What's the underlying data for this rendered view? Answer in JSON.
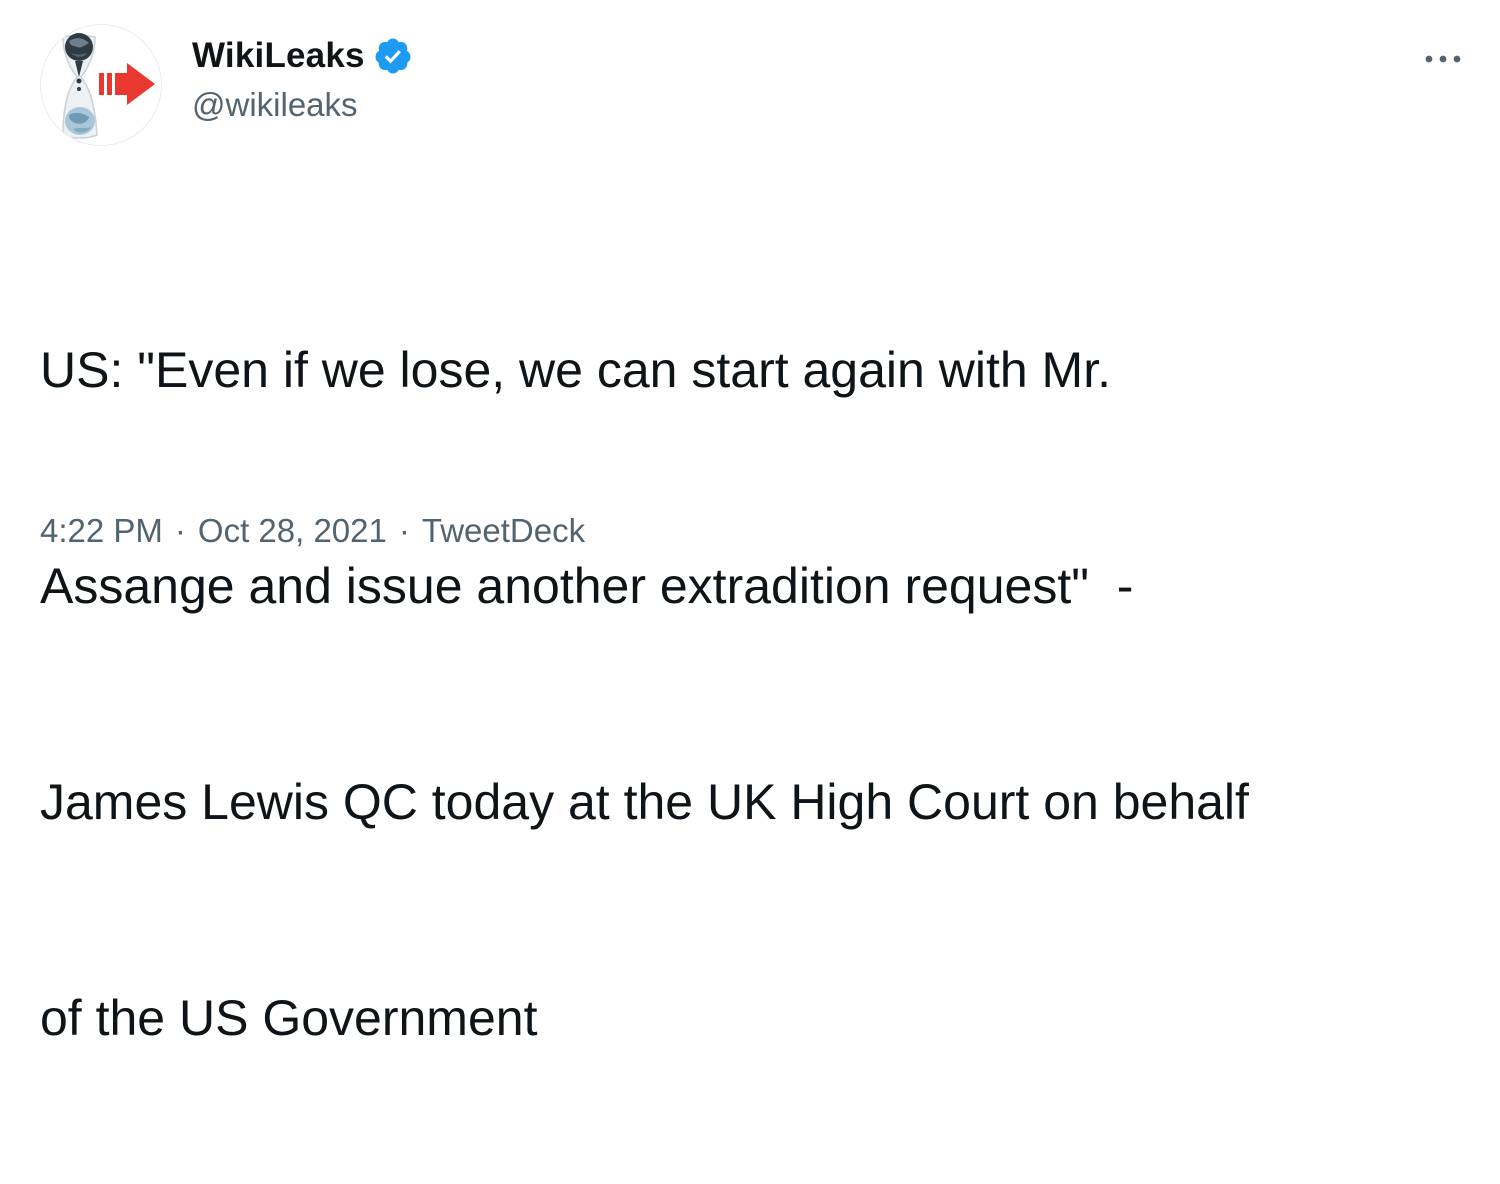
{
  "tweet": {
    "author": {
      "display_name": "WikiLeaks",
      "handle": "@wikileaks",
      "verified": true,
      "avatar_icon": "wikileaks-hourglass-logo-icon"
    },
    "text_lines": [
      "US: \"Even if we lose, we can start again with Mr.",
      "Assange and issue another extradition request\"  -",
      "James Lewis QC today at the UK High Court on behalf",
      "of the US Government"
    ],
    "time": "4:22 PM",
    "date": "Oct 28, 2021",
    "separator": "·",
    "source": "TweetDeck",
    "more_icon": "more-options-icon"
  },
  "colors": {
    "primary_text": "#0f1419",
    "secondary_text": "#536471",
    "verified_blue": "#1d9bf0",
    "logo_red": "#e8382f",
    "background": "#ffffff"
  }
}
